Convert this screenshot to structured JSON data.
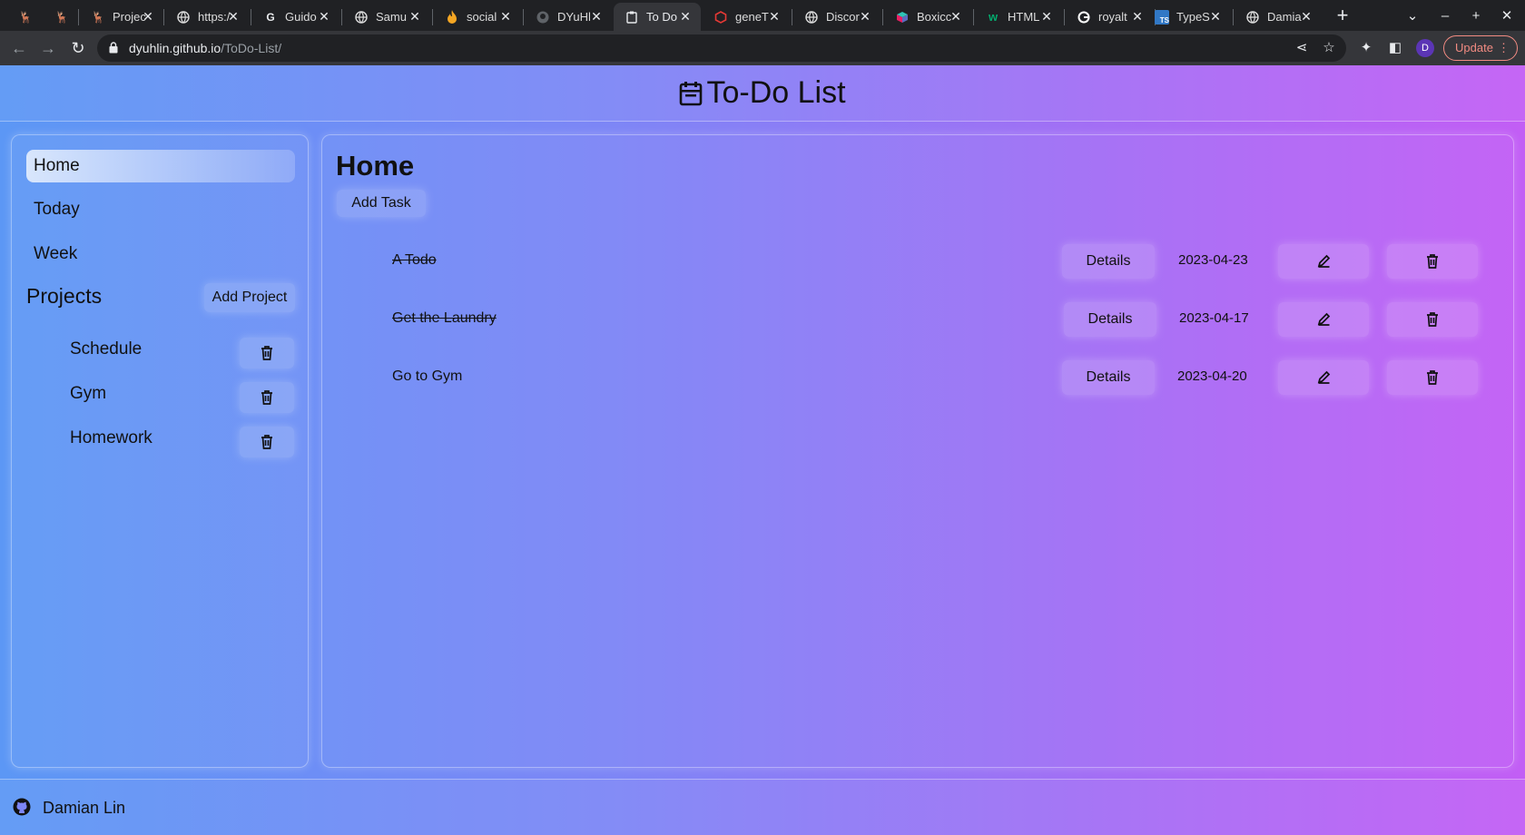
{
  "browser": {
    "tabs": [
      {
        "title": "",
        "favicon": "deer-icon"
      },
      {
        "title": "",
        "favicon": "deer-icon"
      },
      {
        "title": "Projec",
        "favicon": "deer-icon"
      },
      {
        "title": "https:/",
        "favicon": "globe-icon"
      },
      {
        "title": "Guido",
        "favicon": "google-g-icon"
      },
      {
        "title": "Samu",
        "favicon": "globe-icon"
      },
      {
        "title": "social",
        "favicon": "flame-icon"
      },
      {
        "title": "DYuHl",
        "favicon": "github-icon"
      },
      {
        "title": "To Do",
        "favicon": "clipboard-icon",
        "active": true
      },
      {
        "title": "geneT",
        "favicon": "hexagon-icon"
      },
      {
        "title": "Discor",
        "favicon": "globe-icon"
      },
      {
        "title": "Boxicc",
        "favicon": "cube-icon"
      },
      {
        "title": "HTML",
        "favicon": "w-icon"
      },
      {
        "title": "royalt",
        "favicon": "google-icon"
      },
      {
        "title": "TypeS",
        "favicon": "ts-icon"
      },
      {
        "title": "Damia",
        "favicon": "globe-icon"
      }
    ],
    "url_host": "dyuhlin.github.io",
    "url_path": "/ToDo-List/",
    "profile_initial": "D",
    "update_label": "Update"
  },
  "app": {
    "title": "To-Do List",
    "nav": [
      {
        "label": "Home",
        "active": true
      },
      {
        "label": "Today"
      },
      {
        "label": "Week"
      }
    ],
    "projects_title": "Projects",
    "add_project_label": "Add Project",
    "projects": [
      {
        "name": "Schedule"
      },
      {
        "name": "Gym"
      },
      {
        "name": "Homework"
      }
    ],
    "main_title": "Home",
    "add_task_label": "Add Task",
    "tasks": [
      {
        "title": "A Todo",
        "date": "2023-04-23",
        "done": true,
        "details_label": "Details"
      },
      {
        "title": "Get the Laundry",
        "date": "2023-04-17",
        "done": true,
        "details_label": "Details"
      },
      {
        "title": "Go to Gym",
        "date": "2023-04-20",
        "done": false,
        "details_label": "Details"
      }
    ],
    "footer_author": "Damian Lin"
  },
  "colors": {
    "gradient_start": "#5c97f5",
    "gradient_end": "#c25ef5",
    "chrome_bg": "#202124",
    "toolbar_bg": "#35363a",
    "update_accent": "#f28b82"
  }
}
